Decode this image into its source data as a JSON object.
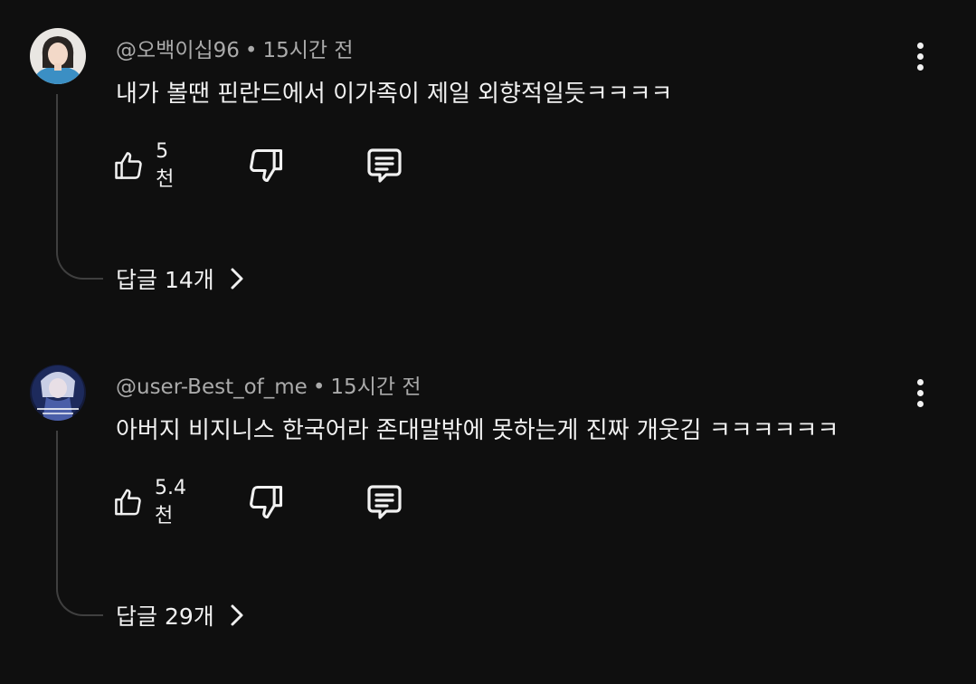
{
  "comments": [
    {
      "author": "@오백이십96",
      "time": "15시간 전",
      "text": "내가 볼땐 핀란드에서 이가족이 제일 외향적일듯ㅋㅋㅋㅋ",
      "likes": "5천",
      "replies_label": "답글 14개"
    },
    {
      "author": "@user-Best_of_me",
      "time": "15시간 전",
      "text": "아버지 비지니스 한국어라 존대말밖에 못하는게 진짜 개웃김  ㅋㅋㅋㅋㅋㅋ",
      "likes": "5.4천",
      "replies_label": "답글 29개"
    }
  ],
  "separator": "•",
  "icons": {
    "like": "thumb-up-icon",
    "dislike": "thumb-down-icon",
    "reply": "comment-icon",
    "more": "more-vert-icon",
    "expand": "chevron-right-icon"
  },
  "colors": {
    "background": "#0f0f0f",
    "text": "#f1f1f1",
    "meta": "#aaaaaa",
    "thread_line": "#3f3f3f"
  }
}
